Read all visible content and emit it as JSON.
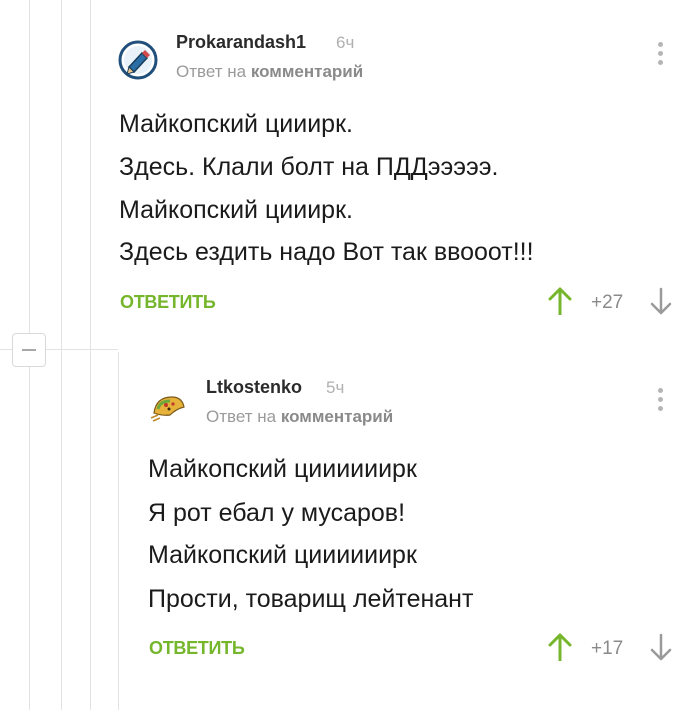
{
  "comments": [
    {
      "author": "Prokarandash1",
      "time": "6ч",
      "reply_prefix": "Ответ на",
      "reply_target": "комментарий",
      "lines": [
        "Майкопский цииирк.",
        "Здесь. Клали болт на ПДДэээээ.",
        "Майкопский цииирк.",
        "Здесь ездить надо Вот так ввооот!!!"
      ],
      "reply_label": "ОТВЕТИТЬ",
      "rating": "+27"
    },
    {
      "author": "Ltkostenko",
      "time": "5ч",
      "reply_prefix": "Ответ на",
      "reply_target": "комментарий",
      "lines": [
        "Майкопский циииииирк",
        "Я рот ебал у мусаров!",
        "Майкопский циииииирк",
        "Прости, товарищ лейтенант"
      ],
      "reply_label": "ОТВЕТИТЬ",
      "rating": "+17"
    }
  ],
  "colors": {
    "accent_green": "#75b62c",
    "muted_gray": "#9a9a9a",
    "thread_line": "#e3e3e3"
  },
  "icons": [
    "avatar-pencil",
    "avatar-taco",
    "kebab-menu",
    "arrow-up",
    "arrow-down",
    "collapse-minus"
  ]
}
